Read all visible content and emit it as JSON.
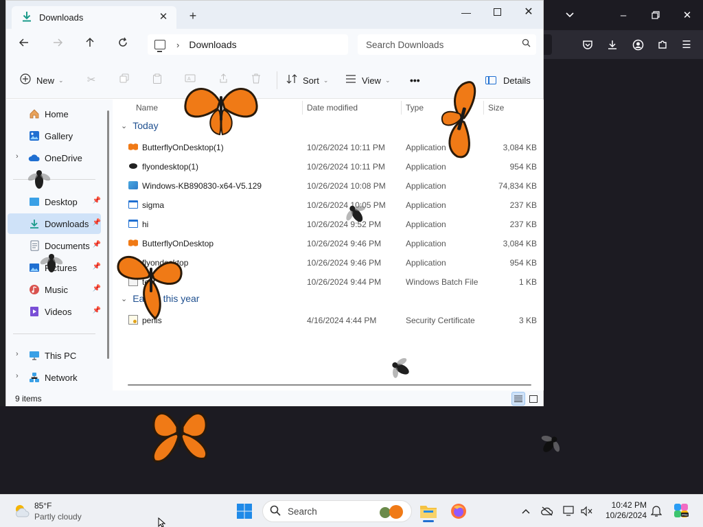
{
  "explorer": {
    "tab_title": "Downloads",
    "address": "Downloads",
    "search_placeholder": "Search Downloads",
    "commands": {
      "new": "New",
      "sort": "Sort",
      "view": "View",
      "more": "•••",
      "details": "Details"
    },
    "sidebar": {
      "items": [
        {
          "label": "Home",
          "icon": "home-icon"
        },
        {
          "label": "Gallery",
          "icon": "gallery-icon"
        },
        {
          "label": "OneDrive",
          "icon": "cloud-icon"
        },
        {
          "label": "Desktop",
          "icon": "desktop-icon"
        },
        {
          "label": "Downloads",
          "icon": "download-icon"
        },
        {
          "label": "Documents",
          "icon": "documents-icon"
        },
        {
          "label": "Pictures",
          "icon": "pictures-icon"
        },
        {
          "label": "Music",
          "icon": "music-icon"
        },
        {
          "label": "Videos",
          "icon": "videos-icon"
        },
        {
          "label": "This PC",
          "icon": "computer-icon"
        },
        {
          "label": "Network",
          "icon": "network-icon"
        }
      ]
    },
    "columns": [
      "Name",
      "Date modified",
      "Type",
      "Size"
    ],
    "groups": [
      {
        "label": "Today",
        "rows": [
          {
            "name": "ButterflyOnDesktop(1)",
            "date": "10/26/2024 10:11 PM",
            "type": "Application",
            "size": "3,084 KB",
            "icon": "butterfly"
          },
          {
            "name": "flyondesktop(1)",
            "date": "10/26/2024 10:11 PM",
            "type": "Application",
            "size": "954 KB",
            "icon": "fly"
          },
          {
            "name": "Windows-KB890830-x64-V5.129",
            "date": "10/26/2024 10:08 PM",
            "type": "Application",
            "size": "74,834 KB",
            "icon": "setup"
          },
          {
            "name": "sigma",
            "date": "10/26/2024 10:05 PM",
            "type": "Application",
            "size": "237 KB",
            "icon": "app"
          },
          {
            "name": "hi",
            "date": "10/26/2024 9:52 PM",
            "type": "Application",
            "size": "237 KB",
            "icon": "app"
          },
          {
            "name": "ButterflyOnDesktop",
            "date": "10/26/2024 9:46 PM",
            "type": "Application",
            "size": "3,084 KB",
            "icon": "butterfly"
          },
          {
            "name": "flyondesktop",
            "date": "10/26/2024 9:46 PM",
            "type": "Application",
            "size": "954 KB",
            "icon": "fly"
          },
          {
            "name": "test",
            "date": "10/26/2024 9:44 PM",
            "type": "Windows Batch File",
            "size": "1 KB",
            "icon": "batch"
          }
        ]
      },
      {
        "label": "Earlier this year",
        "rows": [
          {
            "name": "penis",
            "date": "4/16/2024 4:44 PM",
            "type": "Security Certificate",
            "size": "3 KB",
            "icon": "certificate"
          }
        ]
      }
    ],
    "status": "9 items"
  },
  "taskbar": {
    "weather_temp": "85°F",
    "weather_desc": "Partly cloudy",
    "search_label": "Search",
    "time": "10:42 PM",
    "date": "10/26/2024"
  },
  "colors": {
    "accent": "#1f6fd1",
    "selected": "#cfe2f8",
    "butterfly": "#f07a16",
    "dark_bg": "#1c1b22"
  }
}
